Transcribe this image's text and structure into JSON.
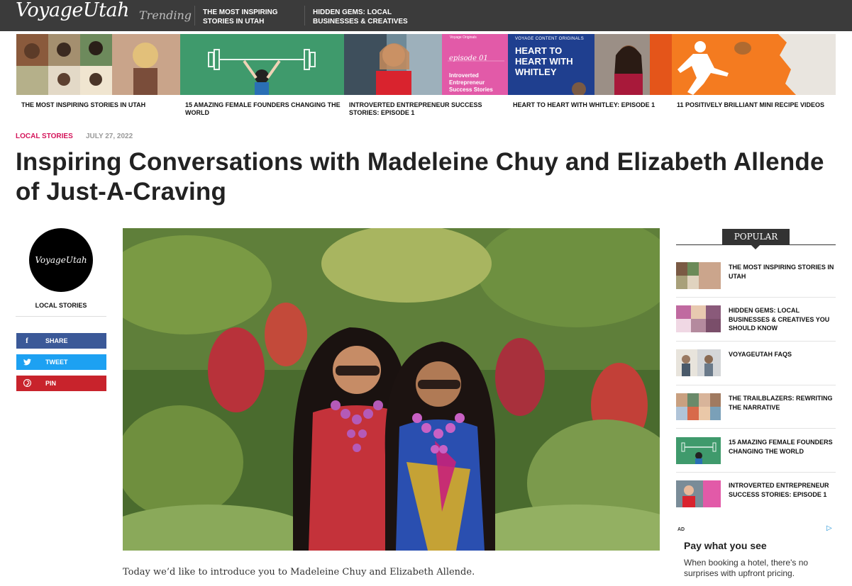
{
  "header": {
    "logo": "VoyageUtah",
    "trending_label": "Trending",
    "links": [
      "THE MOST INSPIRING STORIES IN UTAH",
      "HIDDEN GEMS: LOCAL BUSINESSES & CREATIVES"
    ]
  },
  "trending_strip": [
    {
      "caption": "THE MOST INSPIRING STORIES IN UTAH"
    },
    {
      "caption": "15 AMAZING FEMALE FOUNDERS CHANGING THE WORLD"
    },
    {
      "caption": "INTROVERTED ENTREPRENEUR SUCCESS STORIES: EPISODE 1",
      "overlay_small": "Voyage Originals",
      "overlay_episode": "episode 01",
      "overlay_title": "Introverted Entrepreneur Success Stories"
    },
    {
      "caption": "HEART TO HEART WITH WHITLEY: EPISODE 1",
      "overlay_small": "VOYAGE CONTENT ORIGINALS",
      "overlay_title": "HEART TO HEART WITH WHITLEY"
    },
    {
      "caption": "11 POSITIVELY BRILLIANT MINI RECIPE VIDEOS"
    }
  ],
  "article": {
    "category": "LOCAL STORIES",
    "date": "JULY 27, 2022",
    "title": "Inspiring Conversations with Madeleine Chuy and Elizabeth Allende of Just-A-Craving",
    "intro": "Today we’d like to introduce you to Madeleine Chuy and Elizabeth Allende."
  },
  "author": {
    "avatar_text": "VoyageUtah",
    "category": "LOCAL STORIES"
  },
  "share": {
    "share_label": "SHARE",
    "tweet_label": "TWEET",
    "pin_label": "PIN"
  },
  "popular": {
    "heading": "POPULAR",
    "items": [
      {
        "title": "THE MOST INSPIRING STORIES IN UTAH"
      },
      {
        "title": "HIDDEN GEMS: LOCAL BUSINESSES & CREATIVES YOU SHOULD KNOW"
      },
      {
        "title": "VOYAGEUTAH FAQS"
      },
      {
        "title": "THE TRAILBLAZERS: REWRITING THE NARRATIVE"
      },
      {
        "title": "15 AMAZING FEMALE FOUNDERS CHANGING THE WORLD"
      },
      {
        "title": "INTROVERTED ENTREPRENEUR SUCCESS STORIES: EPISODE 1"
      }
    ]
  },
  "ad": {
    "badge": "AD",
    "headline": "Pay what you see",
    "body": "When booking a hotel, there's no surprises with upfront pricing."
  },
  "colors": {
    "topbar": "#3b3b3b",
    "category_accent": "#d4145a",
    "facebook": "#3b5998",
    "twitter": "#1da1f2",
    "pinterest": "#c8232c"
  }
}
